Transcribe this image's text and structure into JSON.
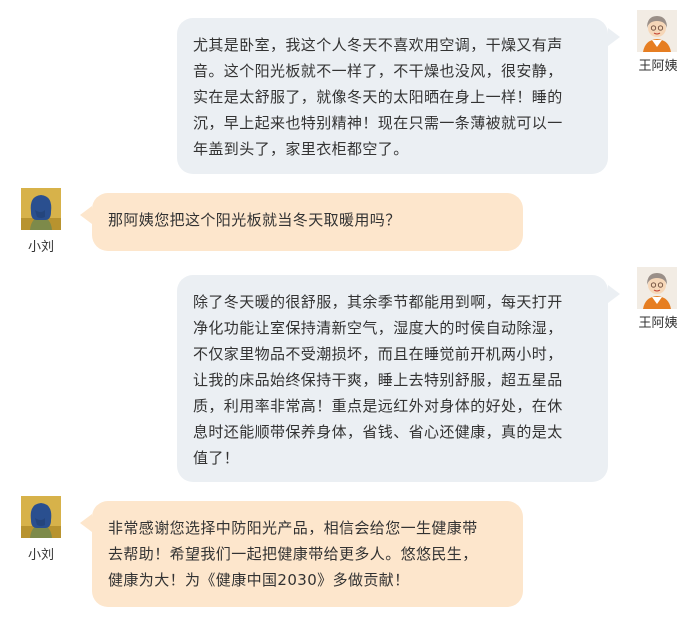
{
  "chat": {
    "messages": [
      {
        "sender": "王阿姨",
        "side": "right",
        "avatar_icon": "elderly-woman-avatar",
        "text": "尤其是卧室，我这个人冬天不喜欢用空调，干燥又有声\n音。这个阳光板就不一样了，不干燥也没风，很安静，\n实在是太舒服了，就像冬天的太阳晒在身上一样！睡的\n沉，早上起来也特别精神！现在只需一条薄被就可以一\n年盖到头了，家里衣柜都空了。"
      },
      {
        "sender": "小刘",
        "side": "left",
        "avatar_icon": "young-woman-avatar",
        "text": "那阿姨您把这个阳光板就当冬天取暖用吗？"
      },
      {
        "sender": "王阿姨",
        "side": "right",
        "avatar_icon": "elderly-woman-avatar",
        "text": "除了冬天暖的很舒服，其余季节都能用到啊，每天打开\n净化功能让室保持清新空气，湿度大的时侯自动除湿，\n不仅家里物品不受潮损坏，而且在睡觉前开机两小时，\n让我的床品始终保持干爽，睡上去特别舒服，超五星品\n质，利用率非常高！重点是远红外对身体的好处，在休\n息时还能顺带保养身体，省钱、省心还健康，真的是太\n值了！"
      },
      {
        "sender": "小刘",
        "side": "left",
        "avatar_icon": "young-woman-avatar",
        "text": "非常感谢您选择中防阳光产品，相信会给您一生健康带\n去帮助！希望我们一起把健康带给更多人。悠悠民生，\n健康为大！为《健康中国2030》多做贡献！"
      }
    ]
  },
  "colors": {
    "right_bubble": "#ebeff3",
    "left_bubble": "#fde6cc",
    "text": "#333333"
  }
}
